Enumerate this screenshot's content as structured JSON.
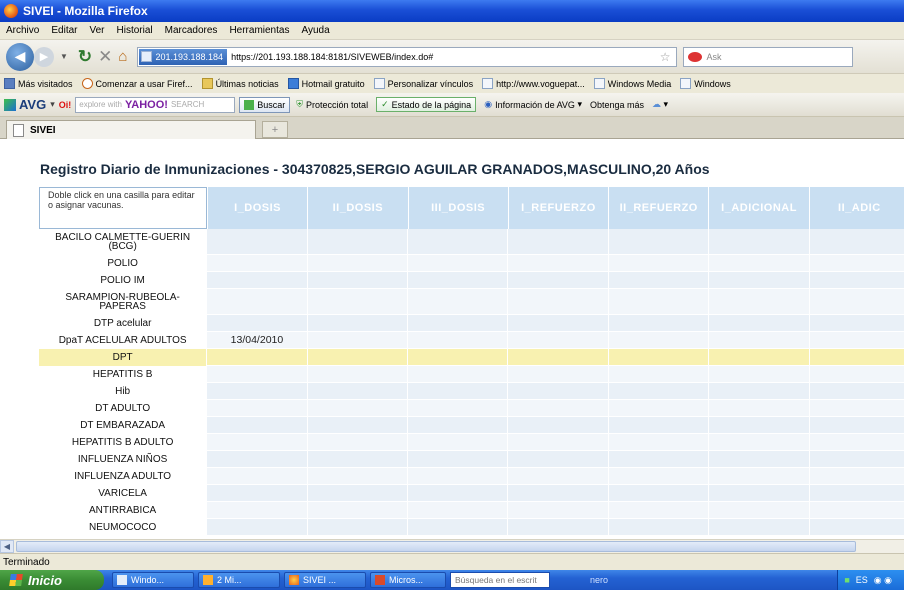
{
  "window": {
    "title": "SIVEI - Mozilla Firefox"
  },
  "menu": [
    "Archivo",
    "Editar",
    "Ver",
    "Historial",
    "Marcadores",
    "Herramientas",
    "Ayuda"
  ],
  "nav": {
    "site_label": "201.193.188.184",
    "url": "https://201.193.188.184:8181/SIVEWEB/index.do#",
    "search_placeholder": "Ask"
  },
  "bookmarks": [
    "Más visitados",
    "Comenzar a usar Firef...",
    "Últimas noticias",
    "Hotmail gratuito",
    "Personalizar vínculos",
    "http://www.voguepat...",
    "Windows Media",
    "Windows"
  ],
  "avg": {
    "logo": "AVG",
    "search_placeholder": "explore with",
    "yahoo": "YAHOO!",
    "search_word": "SEARCH",
    "buscar": "Buscar",
    "proteccion": "Protección total",
    "estado": "Estado de la página",
    "info": "Información de AVG",
    "obtenga": "Obtenga más"
  },
  "tab": {
    "label": "SIVEI"
  },
  "page": {
    "heading": "Registro Diario de Inmunizaciones - 304370825,SERGIO AGUILAR GRANADOS,MASCULINO,20 Años",
    "tip": "Doble click en una casilla para editar o asignar vacunas.",
    "columns": [
      "I_DOSIS",
      "II_DOSIS",
      "III_DOSIS",
      "I_REFUERZO",
      "II_REFUERZO",
      "I_ADICIONAL",
      "II_ADIC"
    ],
    "rows": [
      {
        "label": "BACILO CALMETTE-GUERIN\n(BCG)",
        "cells": [
          "",
          "",
          "",
          "",
          "",
          "",
          ""
        ]
      },
      {
        "label": "POLIO",
        "cells": [
          "",
          "",
          "",
          "",
          "",
          "",
          ""
        ]
      },
      {
        "label": "POLIO IM",
        "cells": [
          "",
          "",
          "",
          "",
          "",
          "",
          ""
        ]
      },
      {
        "label": "SARAMPION-RUBEOLA-\nPAPERAS",
        "cells": [
          "",
          "",
          "",
          "",
          "",
          "",
          ""
        ]
      },
      {
        "label": "DTP acelular",
        "cells": [
          "",
          "",
          "",
          "",
          "",
          "",
          ""
        ]
      },
      {
        "label": "DpaT ACELULAR ADULTOS",
        "cells": [
          "13/04/2010",
          "",
          "",
          "",
          "",
          "",
          ""
        ]
      },
      {
        "label": "DPT",
        "cells": [
          "",
          "",
          "",
          "",
          "",
          "",
          ""
        ]
      },
      {
        "label": "HEPATITIS B",
        "cells": [
          "",
          "",
          "",
          "",
          "",
          "",
          ""
        ]
      },
      {
        "label": "Hib",
        "cells": [
          "",
          "",
          "",
          "",
          "",
          "",
          ""
        ]
      },
      {
        "label": "DT ADULTO",
        "cells": [
          "",
          "",
          "",
          "",
          "",
          "",
          ""
        ]
      },
      {
        "label": "DT EMBARAZADA",
        "cells": [
          "",
          "",
          "",
          "",
          "",
          "",
          ""
        ]
      },
      {
        "label": "HEPATITIS B ADULTO",
        "cells": [
          "",
          "",
          "",
          "",
          "",
          "",
          ""
        ]
      },
      {
        "label": "INFLUENZA NIÑOS",
        "cells": [
          "",
          "",
          "",
          "",
          "",
          "",
          ""
        ]
      },
      {
        "label": "INFLUENZA ADULTO",
        "cells": [
          "",
          "",
          "",
          "",
          "",
          "",
          ""
        ]
      },
      {
        "label": "VARICELA",
        "cells": [
          "",
          "",
          "",
          "",
          "",
          "",
          ""
        ]
      },
      {
        "label": "ANTIRRABICA",
        "cells": [
          "",
          "",
          "",
          "",
          "",
          "",
          ""
        ]
      },
      {
        "label": "NEUMOCOCO",
        "cells": [
          "",
          "",
          "",
          "",
          "",
          "",
          ""
        ]
      }
    ],
    "highlight_row": 6
  },
  "status": {
    "text": "Terminado"
  },
  "taskbar": {
    "start": "Inicio",
    "items": [
      "Windo...",
      "2 Mi...",
      "SIVEI ...",
      "Micros..."
    ],
    "search_placeholder": "Búsqueda en el escrit",
    "nero": "nero",
    "lang": "ES"
  },
  "colors": {
    "header_bg": "#c9dff2",
    "highlight_row": "#f8f1b0",
    "titlebar": "#1a4fd6"
  }
}
